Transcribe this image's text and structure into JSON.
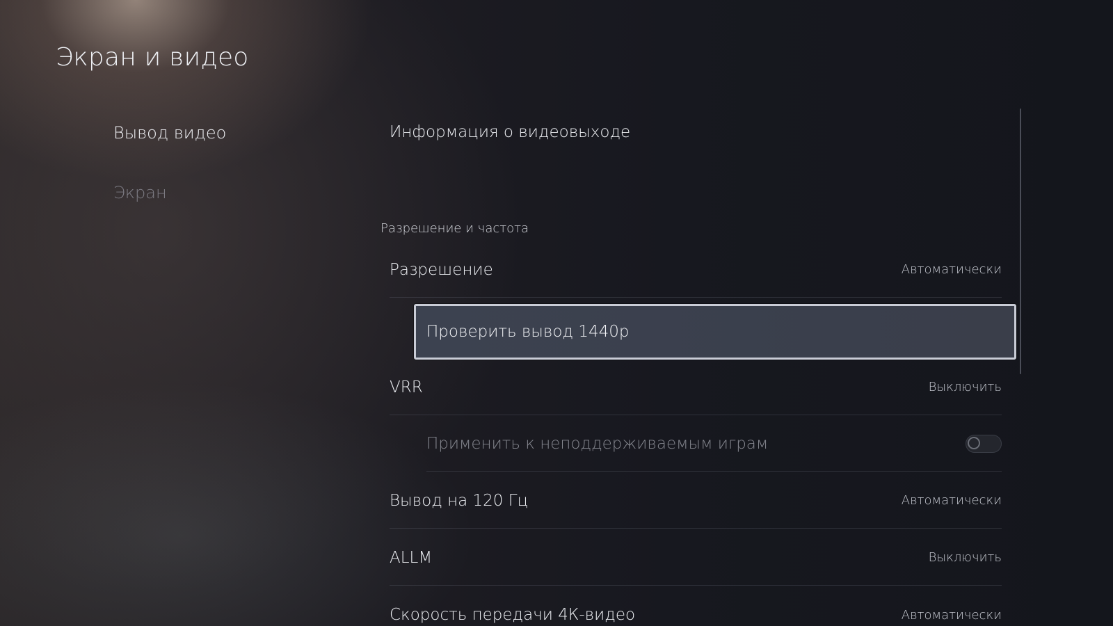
{
  "page": {
    "title": "Экран и видео"
  },
  "nav": {
    "items": [
      {
        "label": "Вывод видео",
        "active": true
      },
      {
        "label": "Экран",
        "active": false
      }
    ]
  },
  "content": {
    "info_row": {
      "label": "Информация о видеовыходе"
    },
    "section_header": "Разрешение и частота",
    "resolution": {
      "label": "Разрешение",
      "value": "Автоматически"
    },
    "test_1440p": {
      "label": "Проверить вывод 1440p"
    },
    "vrr": {
      "label": "VRR",
      "value": "Выключить"
    },
    "vrr_apply_unsupported": {
      "label": "Применить к неподдерживаемым играм",
      "enabled": false
    },
    "output_120hz": {
      "label": "Вывод на 120 Гц",
      "value": "Автоматически"
    },
    "allm": {
      "label": "ALLM",
      "value": "Выключить"
    },
    "transfer_4k": {
      "label": "Скорость передачи 4К-видео",
      "value": "Автоматически"
    }
  },
  "colors": {
    "focus_border": "#c9ccd6",
    "focus_fill": "#3c4250",
    "text_primary": "#eceef2",
    "text_disabled": "#85878f"
  }
}
